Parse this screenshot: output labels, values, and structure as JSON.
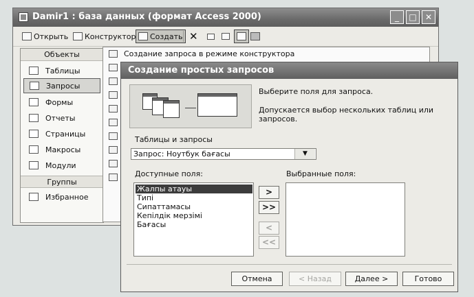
{
  "db_window": {
    "title": "Damir1 : база данных (формат Access 2000)",
    "titlebar_buttons": [
      "_",
      "□",
      "✕"
    ],
    "toolbar": {
      "open_label": "Открыть",
      "design_label": "Конструктор",
      "create_label": "Создать"
    },
    "left_panel": {
      "objects_header": "Объекты",
      "items": [
        {
          "label": "Таблицы",
          "icon": "table-icon"
        },
        {
          "label": "Запросы",
          "icon": "query-icon",
          "selected": true
        },
        {
          "label": "Формы",
          "icon": "form-icon"
        },
        {
          "label": "Отчеты",
          "icon": "report-icon"
        },
        {
          "label": "Страницы",
          "icon": "page-icon"
        },
        {
          "label": "Макросы",
          "icon": "macro-icon"
        },
        {
          "label": "Модули",
          "icon": "module-icon"
        }
      ],
      "groups_header": "Группы",
      "group_items": [
        {
          "label": "Избранное",
          "icon": "favorites-icon"
        }
      ]
    },
    "list": {
      "first_item": "Создание запроса в режиме конструктора"
    }
  },
  "wizard": {
    "title": "Создание простых запросов",
    "desc1": "Выберите поля для запроса.",
    "desc2": "Допускается выбор нескольких таблиц или запросов.",
    "tables_label": "Таблицы и запросы",
    "tables_value": "Запрос: Ноутбук бағасы",
    "available_label": "Доступные поля:",
    "chosen_label": "Выбранные поля:",
    "available_fields": [
      "Жалпы атауы",
      "Типі",
      "Сипаттамасы",
      "Кепілдік мерзімі",
      "Бағасы"
    ],
    "move_buttons": [
      ">",
      ">>",
      "<",
      "<<"
    ],
    "buttons": {
      "cancel": "Отмена",
      "back": "< Назад",
      "next": "Далее >",
      "finish": "Готово"
    }
  }
}
